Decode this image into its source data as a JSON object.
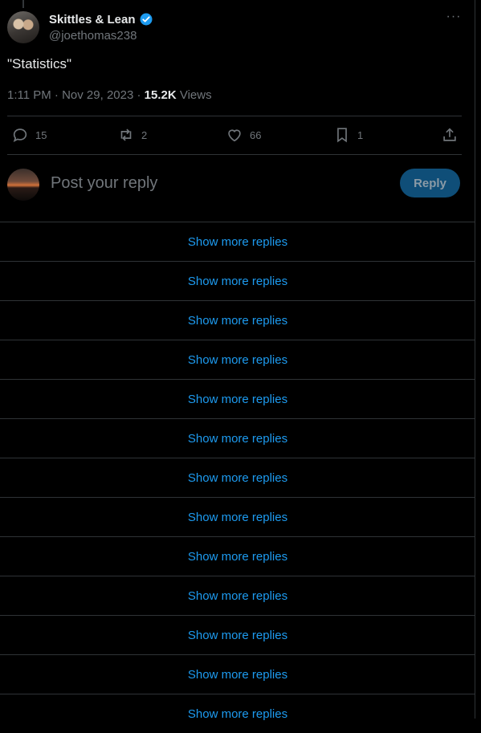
{
  "tweet": {
    "author": {
      "display_name": "Skittles & Lean",
      "handle": "@joethomas238",
      "verified": true
    },
    "text": "\"Statistics\"",
    "time": "1:11 PM · Nov 29, 2023 · ",
    "views_count": "15.2K",
    "views_label": " Views",
    "stats": {
      "replies": "15",
      "reposts": "2",
      "likes": "66",
      "bookmarks": "1"
    }
  },
  "reply_box": {
    "placeholder": "Post your reply",
    "button_label": "Reply"
  },
  "replies_section": {
    "items": [
      "Show more replies",
      "Show more replies",
      "Show more replies",
      "Show more replies",
      "Show more replies",
      "Show more replies",
      "Show more replies",
      "Show more replies",
      "Show more replies",
      "Show more replies",
      "Show more replies",
      "Show more replies",
      "Show more replies"
    ]
  },
  "colors": {
    "accent": "#1d9bf0",
    "background": "#000000",
    "muted": "#71767b",
    "reply_button_bg": "#0f4e78"
  },
  "icons": [
    "more-icon",
    "verified-icon",
    "reply-icon",
    "repost-icon",
    "like-icon",
    "bookmark-icon",
    "share-icon"
  ]
}
